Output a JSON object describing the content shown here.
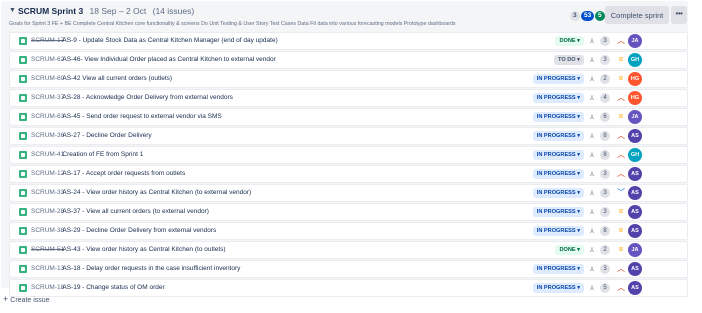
{
  "sprint": {
    "name": "SCRUM Sprint 3",
    "dates": "18 Sep – 2 Oct",
    "issue_count": "(14 issues)",
    "goal": "Goals for Sprint 3 FE + BE Complete Central Kitchen core functionality & screens Do Unit Testing & User Story Test Cases Data Fit data into various forecasting models Prototype dashboards",
    "points_todo": "3",
    "points_in_progress": "53",
    "points_done": "5",
    "complete_label": "Complete sprint",
    "more_label": "•••"
  },
  "colors": {
    "done": "#006644",
    "in_progress": "#0747a6",
    "todo": "#42526e",
    "story": "#36b37e",
    "priority_high": "#de350b",
    "priority_medium": "#ffab00",
    "priority_low": "#0065ff"
  },
  "issues": [
    {
      "key": "SCRUM-17",
      "struck": true,
      "summary": "AS-9 - Update Stock Data as Central Kitchen Manager (end of day update)",
      "status": "DONE ▾",
      "status_type": "done",
      "estimate": "3",
      "priority": "high",
      "priority_icon": "chevron-up-icon",
      "avatar": "JA",
      "avatar_color": "#6554c0"
    },
    {
      "key": "SCRUM-62",
      "struck": false,
      "summary": "AS-46- View Individual Order placed as Central Kitchen to external vendor",
      "status": "TO DO ▾",
      "status_type": "todo",
      "estimate": "3",
      "priority": "medium",
      "priority_icon": "equals-icon",
      "avatar": "GH",
      "avatar_color": "#00a3bf"
    },
    {
      "key": "SCRUM-60",
      "struck": false,
      "summary": "AS-42 View all current orders (outlets)",
      "status": "IN PROGRESS ▾",
      "status_type": "in_progress",
      "estimate": "2",
      "priority": "medium",
      "priority_icon": "equals-icon",
      "avatar": "HG",
      "avatar_color": "#ff5630"
    },
    {
      "key": "SCRUM-37",
      "struck": false,
      "summary": "AS-28 - Acknowledge Order Delivery from external vendors",
      "status": "IN PROGRESS ▾",
      "status_type": "in_progress",
      "estimate": "4",
      "priority": "high",
      "priority_icon": "chevron-up-icon",
      "avatar": "HG",
      "avatar_color": "#ff5630"
    },
    {
      "key": "SCRUM-63",
      "struck": false,
      "summary": "AS-45 - Send order request to external vendor via SMS",
      "status": "IN PROGRESS ▾",
      "status_type": "in_progress",
      "estimate": "6",
      "priority": "medium",
      "priority_icon": "equals-icon",
      "avatar": "JA",
      "avatar_color": "#6554c0"
    },
    {
      "key": "SCRUM-36",
      "struck": false,
      "summary": "AS-27 - Decline Order Delivery",
      "status": "IN PROGRESS ▾",
      "status_type": "in_progress",
      "estimate": "8",
      "priority": "high",
      "priority_icon": "chevron-up-icon",
      "avatar": "AS",
      "avatar_color": "#5243aa"
    },
    {
      "key": "SCRUM-41",
      "struck": false,
      "summary": "Creation of FE from Sprint 1",
      "status": "IN PROGRESS ▾",
      "status_type": "in_progress",
      "estimate": "8",
      "priority": "high",
      "priority_icon": "chevron-up-icon",
      "avatar": "GH",
      "avatar_color": "#00a3bf"
    },
    {
      "key": "SCRUM-12",
      "struck": false,
      "summary": "AS-17 - Accept order requests from outlets",
      "status": "IN PROGRESS ▾",
      "status_type": "in_progress",
      "estimate": "3",
      "priority": "high",
      "priority_icon": "chevron-up-icon",
      "avatar": "AS",
      "avatar_color": "#5243aa"
    },
    {
      "key": "SCRUM-33",
      "struck": false,
      "summary": "AS-24 - View order history as Central Kitchen (to external vendor)",
      "status": "IN PROGRESS ▾",
      "status_type": "in_progress",
      "estimate": "3",
      "priority": "low",
      "priority_icon": "chevron-down-icon",
      "avatar": "AS",
      "avatar_color": "#5243aa"
    },
    {
      "key": "SCRUM-28",
      "struck": false,
      "summary": "AS-37 - View all current orders (to external vendor)",
      "status": "IN PROGRESS ▾",
      "status_type": "in_progress",
      "estimate": "3",
      "priority": "medium",
      "priority_icon": "equals-icon",
      "avatar": "AS",
      "avatar_color": "#5243aa"
    },
    {
      "key": "SCRUM-38",
      "struck": false,
      "summary": "AS-29 - Decline Order Delivery from external vendors",
      "status": "IN PROGRESS ▾",
      "status_type": "in_progress",
      "estimate": "8",
      "priority": "medium",
      "priority_icon": "equals-icon",
      "avatar": "AS",
      "avatar_color": "#5243aa"
    },
    {
      "key": "SCRUM-51",
      "struck": true,
      "summary": "AS-43 - View order history as Central Kitchen (to outlets)",
      "status": "DONE ▾",
      "status_type": "done",
      "estimate": "2",
      "priority": "medium",
      "priority_icon": "equals-icon",
      "avatar": "JA",
      "avatar_color": "#6554c0"
    },
    {
      "key": "SCRUM-13",
      "struck": false,
      "summary": "AS-18 - Delay order requests in the case insufficient inventory",
      "status": "IN PROGRESS ▾",
      "status_type": "in_progress",
      "estimate": "3",
      "priority": "high",
      "priority_icon": "chevron-up-icon",
      "avatar": "AS",
      "avatar_color": "#5243aa"
    },
    {
      "key": "SCRUM-18",
      "struck": false,
      "summary": "AS-19 - Change status of OM order",
      "status": "IN PROGRESS ▾",
      "status_type": "in_progress",
      "estimate": "5",
      "priority": "high",
      "priority_icon": "chevron-up-icon",
      "avatar": "AS",
      "avatar_color": "#5243aa"
    }
  ],
  "create_issue": {
    "plus": "+",
    "label": "Create issue"
  }
}
